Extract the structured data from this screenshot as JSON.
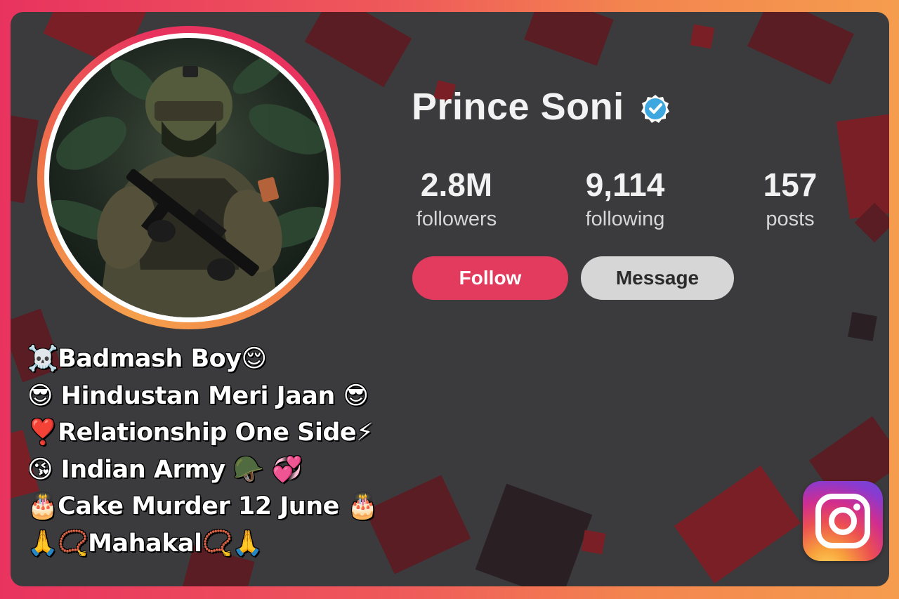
{
  "profile": {
    "name": "Prince Soni",
    "verified_icon": "verified-badge-icon",
    "avatar_icon": "soldier-avatar"
  },
  "stats": [
    {
      "value": "2.8M",
      "label": "followers"
    },
    {
      "value": "9,114",
      "label": "following"
    },
    {
      "value": "157",
      "label": "posts"
    }
  ],
  "actions": {
    "follow_label": "Follow",
    "message_label": "Message"
  },
  "bio": [
    "☠️Badmash Boy😌",
    "😎 Hindustan Meri Jaan 😎",
    "❣️Relationship One Side⚡",
    "😘 Indian Army 🪖 💞",
    "🎂Cake Murder 12 June 🎂",
    "🙏📿Mahakal📿🙏"
  ],
  "colors": {
    "accent": "#e23b5d",
    "card_bg": "#3b3b3d",
    "verified": "#3fa7e0"
  },
  "app_icon": "instagram-icon"
}
